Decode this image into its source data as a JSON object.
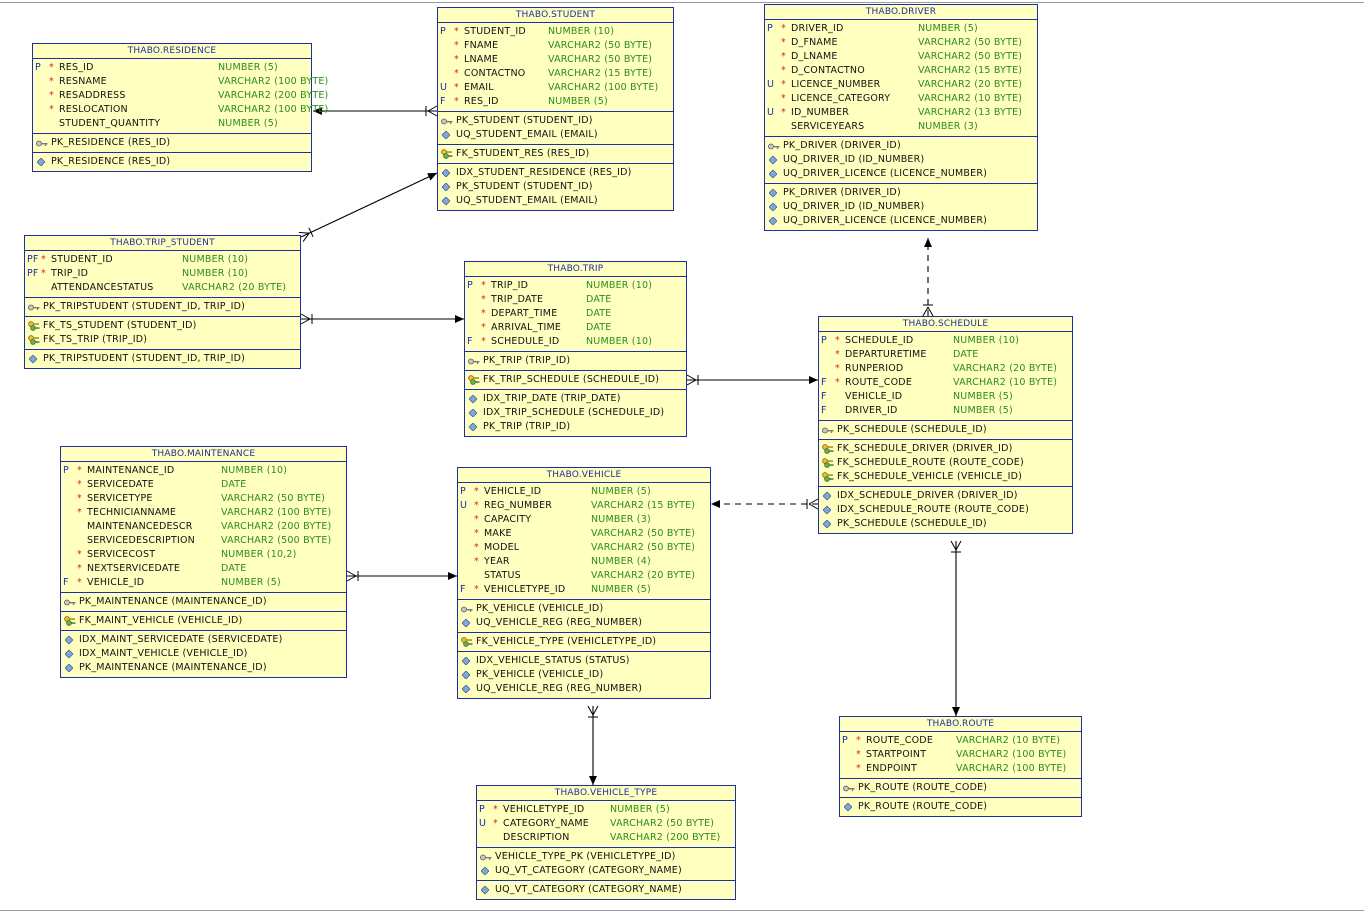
{
  "tables": [
    {
      "id": "residence",
      "title": "THABO.RESIDENCE",
      "cols": [
        {
          "f": "P",
          "st": "*",
          "n": "RES_ID",
          "t": "NUMBER (5)"
        },
        {
          "f": "",
          "st": "*",
          "n": "RESNAME",
          "t": "VARCHAR2 (100 BYTE)"
        },
        {
          "f": "",
          "st": "*",
          "n": "RESADDRESS",
          "t": "VARCHAR2 (200 BYTE)"
        },
        {
          "f": "",
          "st": "*",
          "n": "RESLOCATION",
          "t": "VARCHAR2 (100 BYTE)"
        },
        {
          "f": "",
          "st": "",
          "n": "STUDENT_QUANTITY",
          "t": "NUMBER (5)"
        }
      ],
      "keys": [
        [
          {
            "i": "key",
            "l": "PK_RESIDENCE (RES_ID)"
          }
        ],
        [
          {
            "i": "diamond",
            "l": "PK_RESIDENCE (RES_ID)"
          }
        ]
      ]
    },
    {
      "id": "student",
      "title": "THABO.STUDENT",
      "cols": [
        {
          "f": "P",
          "st": "*",
          "n": "STUDENT_ID",
          "t": "NUMBER (10)"
        },
        {
          "f": "",
          "st": "*",
          "n": "FNAME",
          "t": "VARCHAR2 (50 BYTE)"
        },
        {
          "f": "",
          "st": "*",
          "n": "LNAME",
          "t": "VARCHAR2 (50 BYTE)"
        },
        {
          "f": "",
          "st": "*",
          "n": "CONTACTNO",
          "t": "VARCHAR2 (15 BYTE)"
        },
        {
          "f": "U",
          "st": "*",
          "n": "EMAIL",
          "t": "VARCHAR2 (100 BYTE)"
        },
        {
          "f": "F",
          "st": "*",
          "n": "RES_ID",
          "t": "NUMBER (5)"
        }
      ],
      "keys": [
        [
          {
            "i": "key",
            "l": "PK_STUDENT (STUDENT_ID)"
          },
          {
            "i": "diamond",
            "l": "UQ_STUDENT_EMAIL (EMAIL)"
          }
        ],
        [
          {
            "i": "fk",
            "l": "FK_STUDENT_RES (RES_ID)"
          }
        ],
        [
          {
            "i": "diamond",
            "l": "IDX_STUDENT_RESIDENCE (RES_ID)"
          },
          {
            "i": "diamond",
            "l": "PK_STUDENT (STUDENT_ID)"
          },
          {
            "i": "diamond",
            "l": "UQ_STUDENT_EMAIL (EMAIL)"
          }
        ]
      ]
    },
    {
      "id": "driver",
      "title": "THABO.DRIVER",
      "cols": [
        {
          "f": "P",
          "st": "*",
          "n": "DRIVER_ID",
          "t": "NUMBER (5)"
        },
        {
          "f": "",
          "st": "*",
          "n": "D_FNAME",
          "t": "VARCHAR2 (50 BYTE)"
        },
        {
          "f": "",
          "st": "*",
          "n": "D_LNAME",
          "t": "VARCHAR2 (50 BYTE)"
        },
        {
          "f": "",
          "st": "*",
          "n": "D_CONTACTNO",
          "t": "VARCHAR2 (15 BYTE)"
        },
        {
          "f": "U",
          "st": "*",
          "n": "LICENCE_NUMBER",
          "t": "VARCHAR2 (20 BYTE)"
        },
        {
          "f": "",
          "st": "*",
          "n": "LICENCE_CATEGORY",
          "t": "VARCHAR2 (10 BYTE)"
        },
        {
          "f": "U",
          "st": "*",
          "n": "ID_NUMBER",
          "t": "VARCHAR2 (13 BYTE)"
        },
        {
          "f": "",
          "st": "",
          "n": "SERVICEYEARS",
          "t": "NUMBER (3)"
        }
      ],
      "keys": [
        [
          {
            "i": "key",
            "l": "PK_DRIVER (DRIVER_ID)"
          },
          {
            "i": "diamond",
            "l": "UQ_DRIVER_ID (ID_NUMBER)"
          },
          {
            "i": "diamond",
            "l": "UQ_DRIVER_LICENCE (LICENCE_NUMBER)"
          }
        ],
        [
          {
            "i": "diamond",
            "l": "PK_DRIVER (DRIVER_ID)"
          },
          {
            "i": "diamond",
            "l": "UQ_DRIVER_ID (ID_NUMBER)"
          },
          {
            "i": "diamond",
            "l": "UQ_DRIVER_LICENCE (LICENCE_NUMBER)"
          }
        ]
      ]
    },
    {
      "id": "trip_student",
      "title": "THABO.TRIP_STUDENT",
      "cols": [
        {
          "f": "PF",
          "st": "*",
          "n": "STUDENT_ID",
          "t": "NUMBER (10)"
        },
        {
          "f": "PF",
          "st": "*",
          "n": "TRIP_ID",
          "t": "NUMBER (10)"
        },
        {
          "f": "",
          "st": "",
          "n": "ATTENDANCESTATUS",
          "t": "VARCHAR2 (20 BYTE)"
        }
      ],
      "keys": [
        [
          {
            "i": "key",
            "l": "PK_TRIPSTUDENT (STUDENT_ID, TRIP_ID)"
          }
        ],
        [
          {
            "i": "fk",
            "l": "FK_TS_STUDENT (STUDENT_ID)"
          },
          {
            "i": "fk",
            "l": "FK_TS_TRIP (TRIP_ID)"
          }
        ],
        [
          {
            "i": "diamond",
            "l": "PK_TRIPSTUDENT (STUDENT_ID, TRIP_ID)"
          }
        ]
      ]
    },
    {
      "id": "trip",
      "title": "THABO.TRIP",
      "cols": [
        {
          "f": "P",
          "st": "*",
          "n": "TRIP_ID",
          "t": "NUMBER (10)"
        },
        {
          "f": "",
          "st": "*",
          "n": "TRIP_DATE",
          "t": "DATE"
        },
        {
          "f": "",
          "st": "*",
          "n": "DEPART_TIME",
          "t": "DATE"
        },
        {
          "f": "",
          "st": "*",
          "n": "ARRIVAL_TIME",
          "t": "DATE"
        },
        {
          "f": "F",
          "st": "*",
          "n": "SCHEDULE_ID",
          "t": "NUMBER (10)"
        }
      ],
      "keys": [
        [
          {
            "i": "key",
            "l": "PK_TRIP (TRIP_ID)"
          }
        ],
        [
          {
            "i": "fk",
            "l": "FK_TRIP_SCHEDULE (SCHEDULE_ID)"
          }
        ],
        [
          {
            "i": "diamond",
            "l": "IDX_TRIP_DATE (TRIP_DATE)"
          },
          {
            "i": "diamond",
            "l": "IDX_TRIP_SCHEDULE (SCHEDULE_ID)"
          },
          {
            "i": "diamond",
            "l": "PK_TRIP (TRIP_ID)"
          }
        ]
      ]
    },
    {
      "id": "schedule",
      "title": "THABO.SCHEDULE",
      "cols": [
        {
          "f": "P",
          "st": "*",
          "n": "SCHEDULE_ID",
          "t": "NUMBER (10)"
        },
        {
          "f": "",
          "st": "*",
          "n": "DEPARTURETIME",
          "t": "DATE"
        },
        {
          "f": "",
          "st": "*",
          "n": "RUNPERIOD",
          "t": "VARCHAR2 (20 BYTE)"
        },
        {
          "f": "F",
          "st": "*",
          "n": "ROUTE_CODE",
          "t": "VARCHAR2 (10 BYTE)"
        },
        {
          "f": "F",
          "st": "",
          "n": "VEHICLE_ID",
          "t": "NUMBER (5)"
        },
        {
          "f": "F",
          "st": "",
          "n": "DRIVER_ID",
          "t": "NUMBER (5)"
        }
      ],
      "keys": [
        [
          {
            "i": "key",
            "l": "PK_SCHEDULE (SCHEDULE_ID)"
          }
        ],
        [
          {
            "i": "fk",
            "l": "FK_SCHEDULE_DRIVER (DRIVER_ID)"
          },
          {
            "i": "fk",
            "l": "FK_SCHEDULE_ROUTE (ROUTE_CODE)"
          },
          {
            "i": "fk",
            "l": "FK_SCHEDULE_VEHICLE (VEHICLE_ID)"
          }
        ],
        [
          {
            "i": "diamond",
            "l": "IDX_SCHEDULE_DRIVER (DRIVER_ID)"
          },
          {
            "i": "diamond",
            "l": "IDX_SCHEDULE_ROUTE (ROUTE_CODE)"
          },
          {
            "i": "diamond",
            "l": "PK_SCHEDULE (SCHEDULE_ID)"
          }
        ]
      ]
    },
    {
      "id": "maintenance",
      "title": "THABO.MAINTENANCE",
      "cols": [
        {
          "f": "P",
          "st": "*",
          "n": "MAINTENANCE_ID",
          "t": "NUMBER (10)"
        },
        {
          "f": "",
          "st": "*",
          "n": "SERVICEDATE",
          "t": "DATE"
        },
        {
          "f": "",
          "st": "*",
          "n": "SERVICETYPE",
          "t": "VARCHAR2 (50 BYTE)"
        },
        {
          "f": "",
          "st": "*",
          "n": "TECHNICIANNAME",
          "t": "VARCHAR2 (100 BYTE)"
        },
        {
          "f": "",
          "st": "",
          "n": "MAINTENANCEDESCR",
          "t": "VARCHAR2 (200 BYTE)"
        },
        {
          "f": "",
          "st": "",
          "n": "SERVICEDESCRIPTION",
          "t": "VARCHAR2 (500 BYTE)"
        },
        {
          "f": "",
          "st": "*",
          "n": "SERVICECOST",
          "t": "NUMBER (10,2)"
        },
        {
          "f": "",
          "st": "*",
          "n": "NEXTSERVICEDATE",
          "t": "DATE"
        },
        {
          "f": "F",
          "st": "*",
          "n": "VEHICLE_ID",
          "t": "NUMBER (5)"
        }
      ],
      "keys": [
        [
          {
            "i": "key",
            "l": "PK_MAINTENANCE (MAINTENANCE_ID)"
          }
        ],
        [
          {
            "i": "fk",
            "l": "FK_MAINT_VEHICLE (VEHICLE_ID)"
          }
        ],
        [
          {
            "i": "diamond",
            "l": "IDX_MAINT_SERVICEDATE (SERVICEDATE)"
          },
          {
            "i": "diamond",
            "l": "IDX_MAINT_VEHICLE (VEHICLE_ID)"
          },
          {
            "i": "diamond",
            "l": "PK_MAINTENANCE (MAINTENANCE_ID)"
          }
        ]
      ]
    },
    {
      "id": "vehicle",
      "title": "THABO.VEHICLE",
      "cols": [
        {
          "f": "P",
          "st": "*",
          "n": "VEHICLE_ID",
          "t": "NUMBER (5)"
        },
        {
          "f": "U",
          "st": "*",
          "n": "REG_NUMBER",
          "t": "VARCHAR2 (15 BYTE)"
        },
        {
          "f": "",
          "st": "*",
          "n": "CAPACITY",
          "t": "NUMBER (3)"
        },
        {
          "f": "",
          "st": "*",
          "n": "MAKE",
          "t": "VARCHAR2 (50 BYTE)"
        },
        {
          "f": "",
          "st": "*",
          "n": "MODEL",
          "t": "VARCHAR2 (50 BYTE)"
        },
        {
          "f": "",
          "st": "*",
          "n": "YEAR",
          "t": "NUMBER (4)"
        },
        {
          "f": "",
          "st": "",
          "n": "STATUS",
          "t": "VARCHAR2 (20 BYTE)"
        },
        {
          "f": "F",
          "st": "*",
          "n": "VEHICLETYPE_ID",
          "t": "NUMBER (5)"
        }
      ],
      "keys": [
        [
          {
            "i": "key",
            "l": "PK_VEHICLE (VEHICLE_ID)"
          },
          {
            "i": "diamond",
            "l": "UQ_VEHICLE_REG (REG_NUMBER)"
          }
        ],
        [
          {
            "i": "fk",
            "l": "FK_VEHICLE_TYPE (VEHICLETYPE_ID)"
          }
        ],
        [
          {
            "i": "diamond",
            "l": "IDX_VEHICLE_STATUS (STATUS)"
          },
          {
            "i": "diamond",
            "l": "PK_VEHICLE (VEHICLE_ID)"
          },
          {
            "i": "diamond",
            "l": "UQ_VEHICLE_REG (REG_NUMBER)"
          }
        ]
      ]
    },
    {
      "id": "route",
      "title": "THABO.ROUTE",
      "cols": [
        {
          "f": "P",
          "st": "*",
          "n": "ROUTE_CODE",
          "t": "VARCHAR2 (10 BYTE)"
        },
        {
          "f": "",
          "st": "*",
          "n": "STARTPOINT",
          "t": "VARCHAR2 (100 BYTE)"
        },
        {
          "f": "",
          "st": "*",
          "n": "ENDPOINT",
          "t": "VARCHAR2 (100 BYTE)"
        }
      ],
      "keys": [
        [
          {
            "i": "key",
            "l": "PK_ROUTE (ROUTE_CODE)"
          }
        ],
        [
          {
            "i": "diamond",
            "l": "PK_ROUTE (ROUTE_CODE)"
          }
        ]
      ]
    },
    {
      "id": "vehicle_type",
      "title": "THABO.VEHICLE_TYPE",
      "cols": [
        {
          "f": "P",
          "st": "*",
          "n": "VEHICLETYPE_ID",
          "t": "NUMBER (5)"
        },
        {
          "f": "U",
          "st": "*",
          "n": "CATEGORY_NAME",
          "t": "VARCHAR2 (50 BYTE)"
        },
        {
          "f": "",
          "st": "",
          "n": "DESCRIPTION",
          "t": "VARCHAR2 (200 BYTE)"
        }
      ],
      "keys": [
        [
          {
            "i": "key",
            "l": "VEHICLE_TYPE_PK (VEHICLETYPE_ID)"
          },
          {
            "i": "diamond",
            "l": "UQ_VT_CATEGORY (CATEGORY_NAME)"
          }
        ],
        [
          {
            "i": "diamond",
            "l": "UQ_VT_CATEGORY (CATEGORY_NAME)"
          }
        ]
      ]
    }
  ],
  "relationships": [
    {
      "from": "student",
      "to": "residence",
      "style": "solid",
      "fk": "FK_STUDENT_RES"
    },
    {
      "from": "trip_student",
      "to": "student",
      "style": "solid",
      "fk": "FK_TS_STUDENT"
    },
    {
      "from": "trip_student",
      "to": "trip",
      "style": "solid",
      "fk": "FK_TS_TRIP"
    },
    {
      "from": "trip",
      "to": "schedule",
      "style": "solid",
      "fk": "FK_TRIP_SCHEDULE"
    },
    {
      "from": "schedule",
      "to": "driver",
      "style": "dashed",
      "fk": "FK_SCHEDULE_DRIVER"
    },
    {
      "from": "schedule",
      "to": "vehicle",
      "style": "dashed",
      "fk": "FK_SCHEDULE_VEHICLE"
    },
    {
      "from": "schedule",
      "to": "route",
      "style": "solid",
      "fk": "FK_SCHEDULE_ROUTE"
    },
    {
      "from": "maintenance",
      "to": "vehicle",
      "style": "solid",
      "fk": "FK_MAINT_VEHICLE"
    },
    {
      "from": "vehicle",
      "to": "vehicle_type",
      "style": "solid",
      "fk": "FK_VEHICLE_TYPE"
    }
  ],
  "colors": {
    "table_fill": "#ffffc0",
    "border": "#1c2fa3",
    "title": "#1c2fa3",
    "type": "#2e8b1e",
    "mandatory": "#e02020",
    "line": "#000000"
  }
}
